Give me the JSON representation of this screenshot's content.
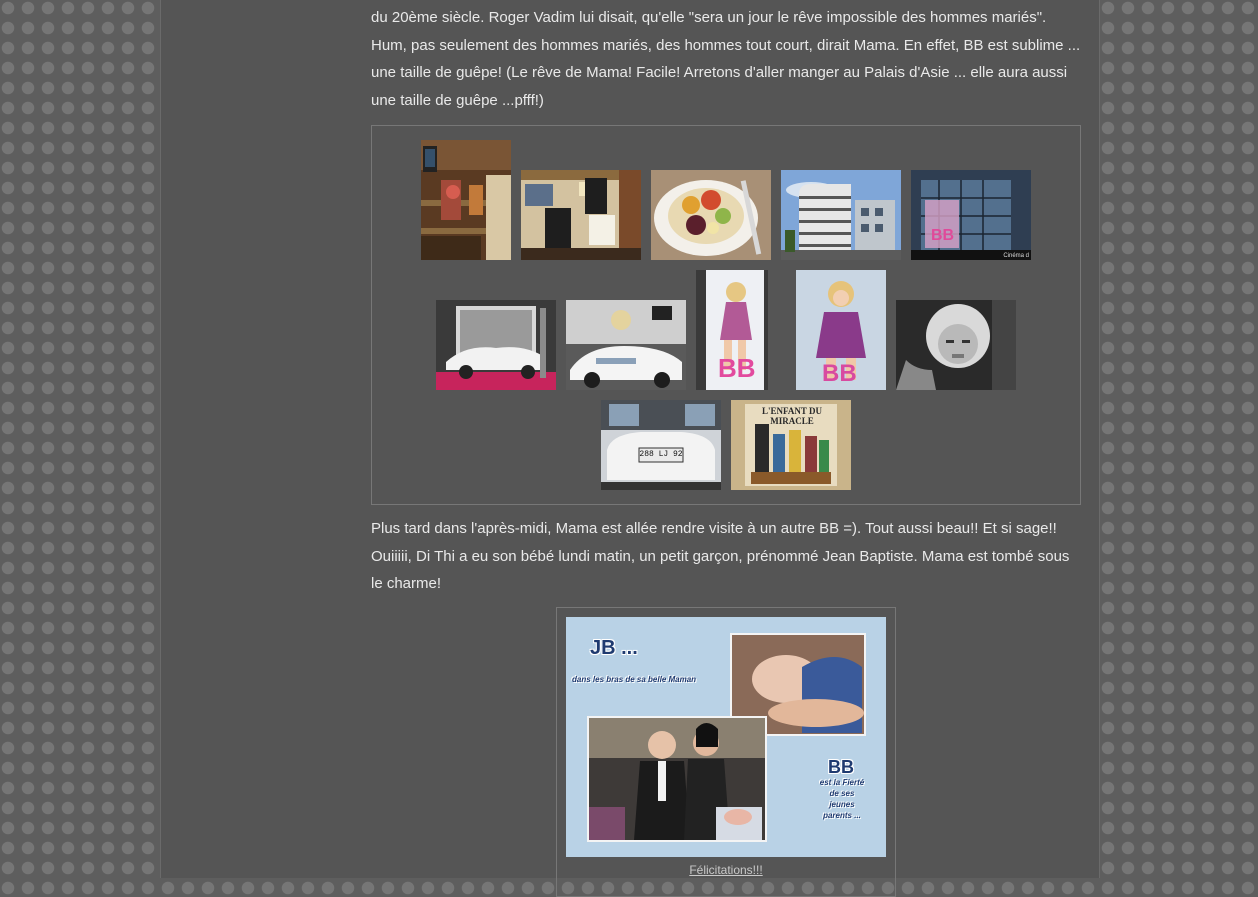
{
  "article": {
    "paragraph_1": "du 20ème siècle. Roger Vadim lui disait, qu'elle \"sera un jour le rêve impossible des hommes mariés\". Hum, pas seulement des hommes mariés, des hommes tout court, dirait Mama. En effet, BB est sublime ... une taille de guêpe! (Le rêve de Mama! Facile! Arretons d'aller manger au Palais d'Asie ... elle aura aussi une taille de guêpe ...pfff!)",
    "paragraph_2": "Plus tard dans l'après-midi, Mama est allée rendre visite à un autre BB =). Tout aussi beau!! Et si sage!! Ouiiiii, Di Thi a eu son bébé lundi matin, un petit garçon, prénommé Jean Baptiste. Mama est tombé sous le charme!"
  },
  "gallery": {
    "photos": [
      {
        "name": "photo-bookshop-interior",
        "text": ""
      },
      {
        "name": "photo-restaurant-menu-board",
        "text": ""
      },
      {
        "name": "photo-plate-of-food",
        "text": ""
      },
      {
        "name": "photo-modern-building",
        "text": ""
      },
      {
        "name": "photo-cinema-facade",
        "text": "Cinéma d"
      },
      {
        "name": "photo-white-convertible-exhibit",
        "text": ""
      },
      {
        "name": "photo-convertible-closeup",
        "text": ""
      },
      {
        "name": "photo-bb-poster-left",
        "text": "BB"
      },
      {
        "name": "photo-bb-poster-right",
        "text": "BB"
      },
      {
        "name": "photo-bb-portrait-bw",
        "text": ""
      },
      {
        "name": "photo-car-rear-plate",
        "text": "288 LJ 92"
      },
      {
        "name": "photo-lenfant-du-miracle-poster",
        "text": "L'ENFANT DU MIRACLE"
      }
    ]
  },
  "feature": {
    "title": "JB ...",
    "subtitle": "dans les bras de sa belle Maman",
    "side_title": "BB",
    "side_lines": [
      "est la Fierté",
      "de ses",
      "jeunes",
      "parents ..."
    ],
    "caption": "Félicitations!!!"
  }
}
